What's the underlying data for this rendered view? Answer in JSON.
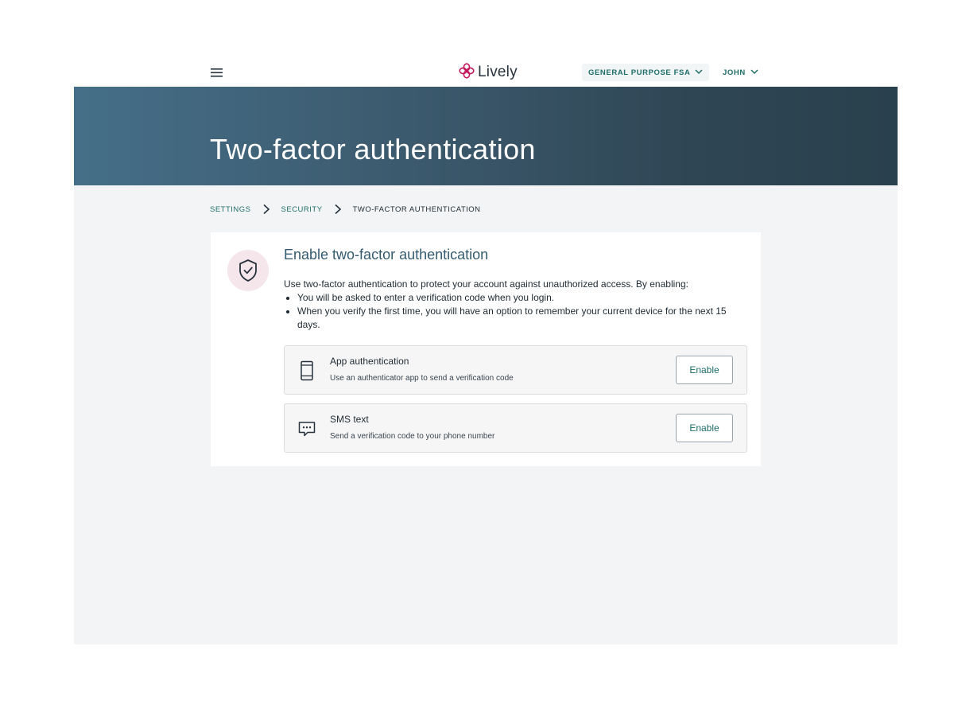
{
  "nav": {
    "logo_text": "Lively",
    "account_label": "GENERAL PURPOSE FSA",
    "user_label": "JOHN",
    "icons": {
      "menu": "hamburger-menu-icon",
      "logo": "lively-flower-logo",
      "account_chevron": "chevron-down-icon",
      "user_chevron": "chevron-down-icon"
    }
  },
  "hero": {
    "title": "Two-factor authentication"
  },
  "breadcrumb": {
    "items": [
      "SETTINGS",
      "SECURITY",
      "TWO-FACTOR AUTHENTICATION"
    ]
  },
  "card": {
    "title": "Enable two-factor authentication",
    "intro": "Use two-factor authentication to protect your account against unauthorized access. By enabling:",
    "bullets": [
      "You will be asked to enter a verification code when you login.",
      "When you verify the first time, you will have an option to remember your current device for the next 15 days."
    ],
    "methods": [
      {
        "title": "App authentication",
        "description": "Use an authenticator app to send a verification code",
        "button": "Enable",
        "icon": "mobile-phone-icon"
      },
      {
        "title": "SMS text",
        "description": "Send a verification code to your phone number",
        "button": "Enable",
        "icon": "chat-bubble-icon"
      }
    ]
  },
  "colors": {
    "accent": "#1e6e6a",
    "brand_pink": "#c2185b",
    "hero_start": "#456f88",
    "hero_end": "#29404d",
    "title_blue": "#355b70",
    "page_bg": "#f3f4f5"
  }
}
